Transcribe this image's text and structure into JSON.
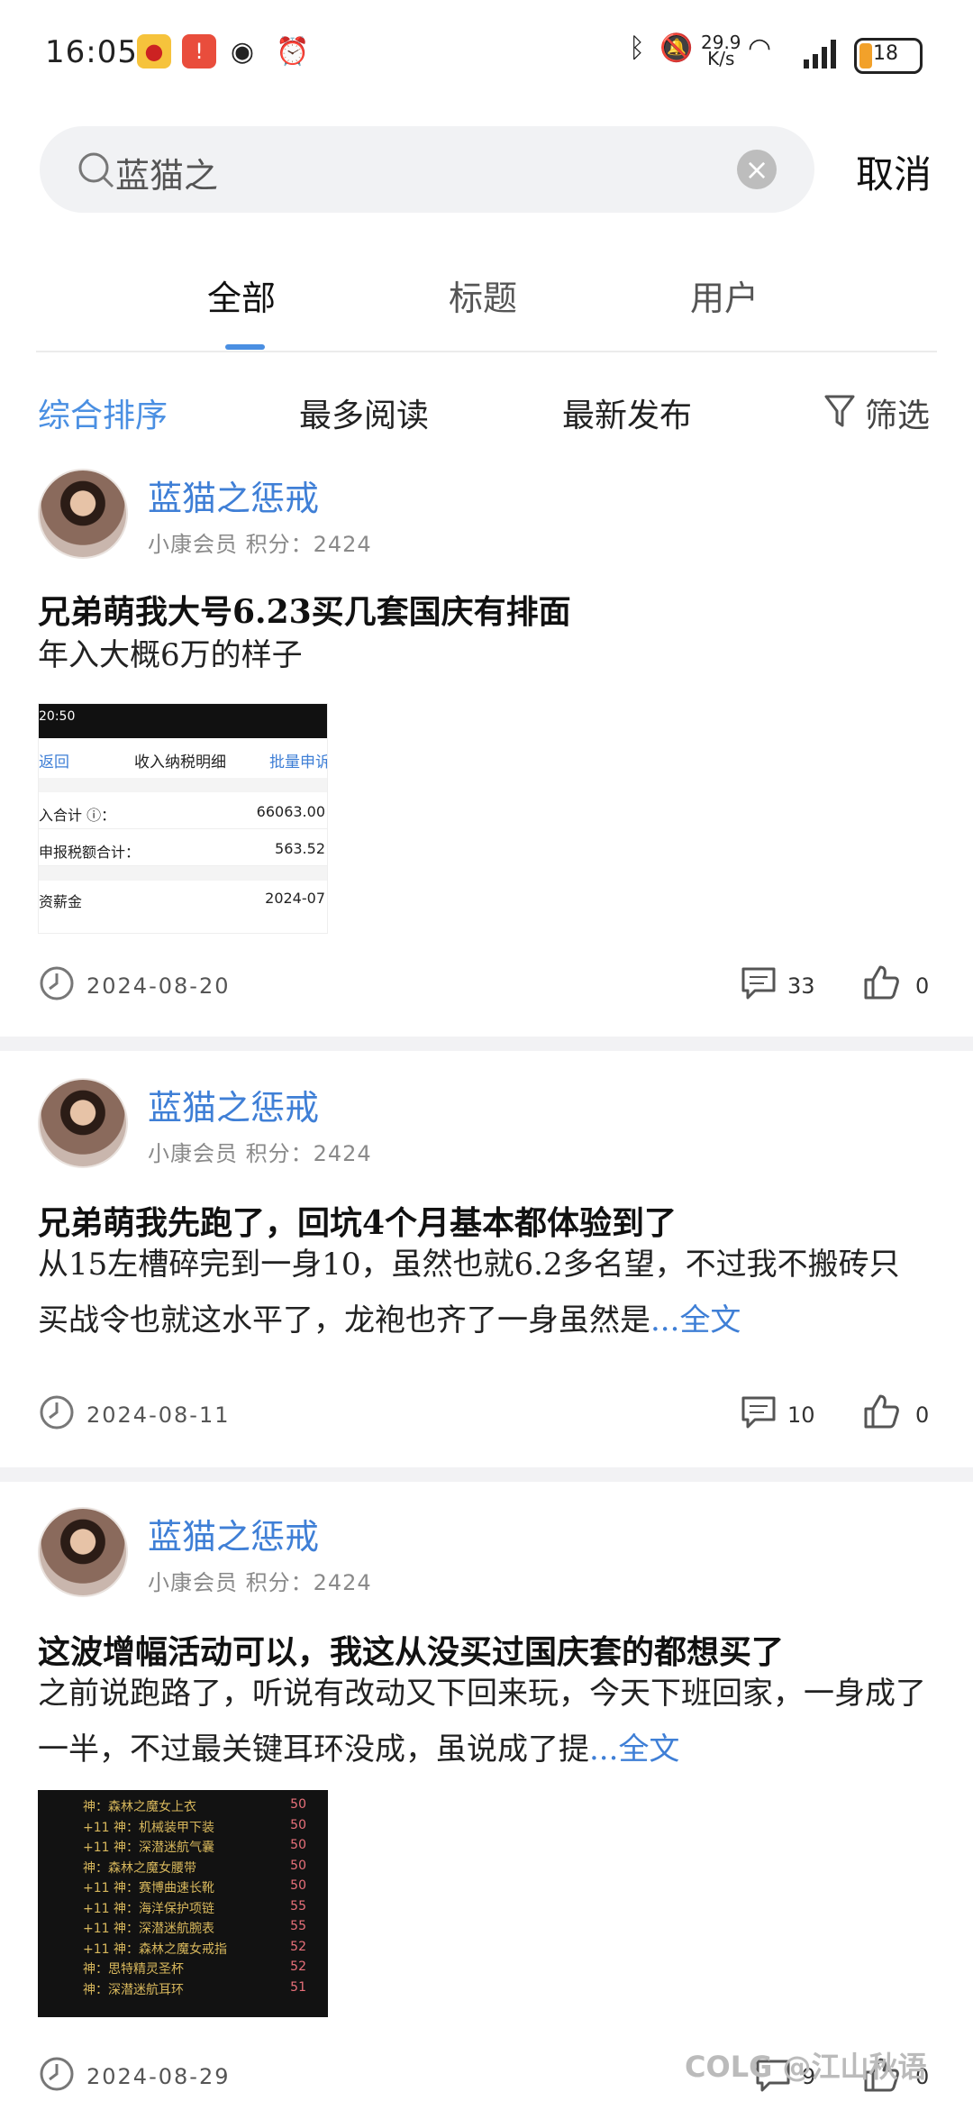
{
  "status_bar": {
    "time": "16:05",
    "net_speed_value": "29.9",
    "net_speed_unit": "K/s",
    "battery": "18",
    "icons": [
      "weibo-icon",
      "app-red-icon",
      "eye-icon",
      "alarm-icon",
      "bluetooth-icon",
      "mute-icon",
      "wifi-icon",
      "signal-icon",
      "battery-icon"
    ]
  },
  "search": {
    "value": "蓝猫之",
    "cancel_label": "取消"
  },
  "tabs": [
    {
      "label": "全部",
      "active": true
    },
    {
      "label": "标题",
      "active": false
    },
    {
      "label": "用户",
      "active": false
    }
  ],
  "sort": {
    "options": [
      "综合排序",
      "最多阅读",
      "最新发布"
    ],
    "active": "综合排序",
    "filter_label": "筛选"
  },
  "posts": [
    {
      "author": "蓝猫之惩戒",
      "meta": "小康会员 积分：2424",
      "title": "兄弟萌我大号6.23买几套国庆有排面",
      "body": "年入大概6万的样子",
      "date": "2024-08-20",
      "comments": "33",
      "likes": "0",
      "image": {
        "time": "20:50",
        "back": "返回",
        "title": "收入纳税明细",
        "action": "批量申诉",
        "rows": [
          {
            "label": "入合计 ⓘ：",
            "value": "66063.00"
          },
          {
            "label": "申报税额合计：",
            "value": "563.52"
          },
          {
            "label": "资薪金",
            "value": "2024-07"
          }
        ]
      }
    },
    {
      "author": "蓝猫之惩戒",
      "meta": "小康会员 积分：2424",
      "title": "兄弟萌我先跑了，回坑4个月基本都体验到了",
      "body": "从15左槽碎完到一身10，虽然也就6.2多名望，不过我不搬砖只买战令也就这水平了，龙袍也齐了一身虽然是",
      "ellipsis": "...",
      "full_label": "全文",
      "date": "2024-08-11",
      "comments": "10",
      "likes": "0"
    },
    {
      "author": "蓝猫之惩戒",
      "meta": "小康会员 积分：2424",
      "title": "这波增幅活动可以，我这从没买过国庆套的都想买了",
      "body": "之前说跑路了，听说有改动又下回来玩，今天下班回家，一身成了一半，不过最关键耳环没成，虽说成了提",
      "ellipsis": "...",
      "full_label": "全文",
      "date": "2024-08-29",
      "comments": "9",
      "likes": "0",
      "image_rows": [
        {
          "text": "神：森林之魔女上衣",
          "value": "50"
        },
        {
          "text": "+11 神：机械装甲下装",
          "value": "50"
        },
        {
          "text": "+11 神：深潜迷航气囊",
          "value": "50"
        },
        {
          "text": "神：森林之魔女腰带",
          "value": "50"
        },
        {
          "text": "+11 神：赛博曲速长靴",
          "value": "50"
        },
        {
          "text": "+11 神：海洋保护项链",
          "value": "55"
        },
        {
          "text": "+11 神：深潜迷航腕表",
          "value": "55"
        },
        {
          "text": "+11 神：森林之魔女戒指",
          "value": "52"
        },
        {
          "text": "神：思特精灵圣杯",
          "value": "52"
        },
        {
          "text": "神：深潜迷航耳环",
          "value": "51"
        }
      ]
    }
  ],
  "watermark": "COLG @江山秋语"
}
